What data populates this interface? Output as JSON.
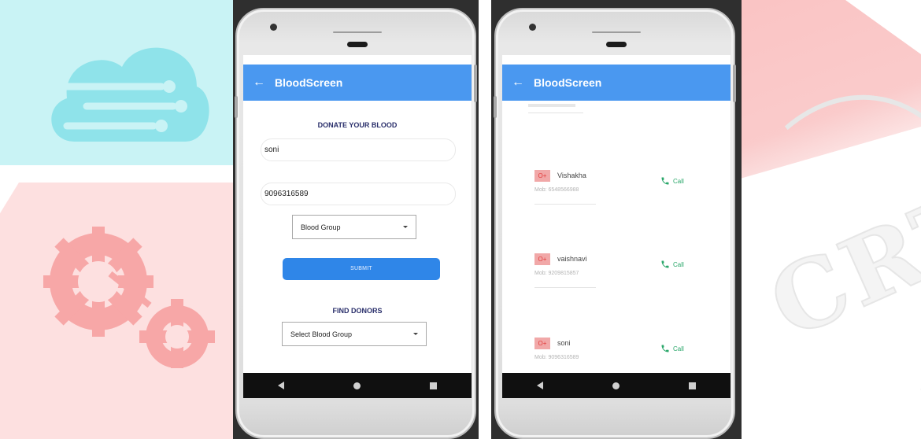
{
  "watermark": {
    "text": "CRT"
  },
  "phones": [
    {
      "app_title": "BloodScreen",
      "donate_section": {
        "heading": "DONATE YOUR BLOOD",
        "name_value": "soni",
        "phone_value": "9096316589",
        "blood_group_select": "Blood Group",
        "submit_label": "SUBMIT"
      },
      "find_section": {
        "heading": "FIND DONORS",
        "select_label": "Select Blood Group"
      }
    },
    {
      "app_title": "BloodScreen",
      "donors": [
        {
          "group": "O+",
          "name": "Vishakha",
          "mobile": "Mob: 6548566988",
          "call_label": "Call"
        },
        {
          "group": "O+",
          "name": "vaishnavi",
          "mobile": "Mob: 9209815857",
          "call_label": "Call"
        },
        {
          "group": "O+",
          "name": "soni",
          "mobile": "Mob: 9096316589",
          "call_label": "Call"
        }
      ]
    }
  ],
  "colors": {
    "appbar": "#4a98f0",
    "submit": "#2f86e8",
    "badge_bg": "#f1a8a8",
    "badge_text": "#e23b3b",
    "call": "#2aa76a",
    "heading": "#2a2f6b"
  },
  "icons": [
    "back-arrow-icon",
    "dropdown-caret-icon",
    "call-phone-icon",
    "nav-back-icon",
    "nav-home-icon",
    "nav-recents-icon"
  ]
}
